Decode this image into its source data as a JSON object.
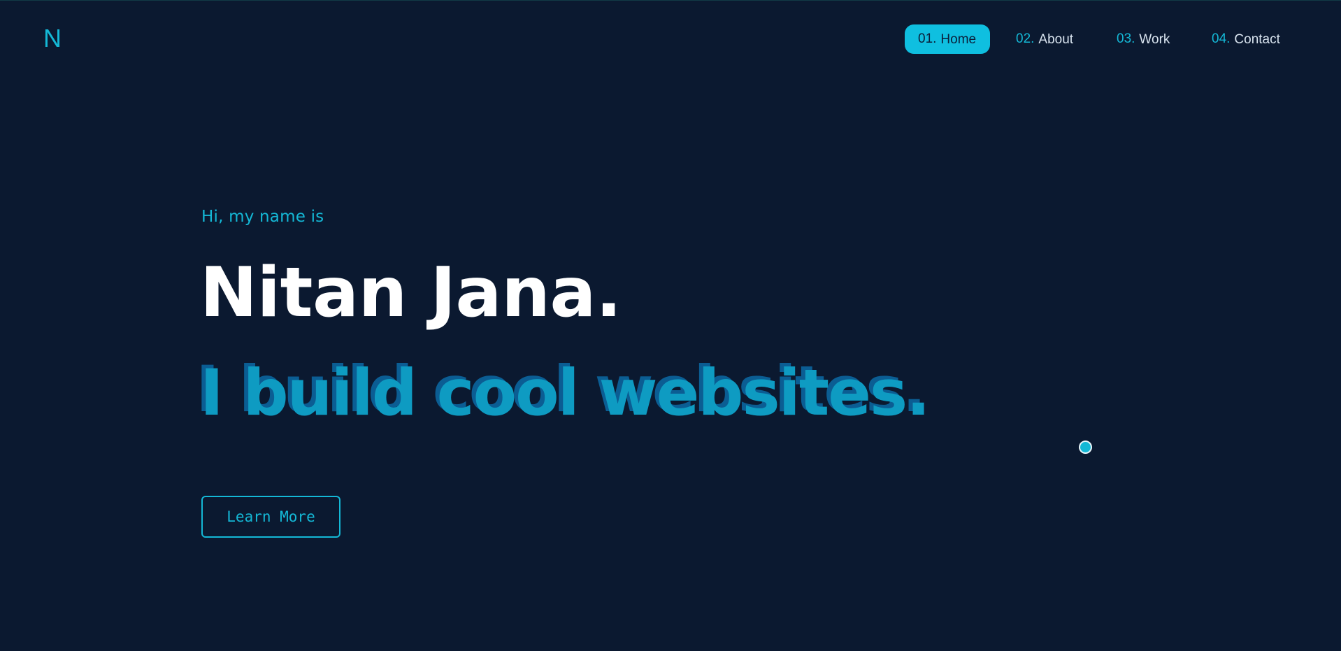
{
  "header": {
    "logo": "N",
    "nav": [
      {
        "num": "01.",
        "label": "Home",
        "active": true
      },
      {
        "num": "02.",
        "label": "About",
        "active": false
      },
      {
        "num": "03.",
        "label": "Work",
        "active": false
      },
      {
        "num": "04.",
        "label": "Contact",
        "active": false
      }
    ]
  },
  "hero": {
    "intro": "Hi, my name is",
    "name": "Nitan Jana.",
    "tagline": "I build cool websites.",
    "cta_label": "Learn More"
  },
  "colors": {
    "background": "#0b1930",
    "accent": "#14b8d6",
    "tagline": "#0e9bc2",
    "tagline_shadow": "#0b5d93",
    "text": "#ffffff"
  }
}
